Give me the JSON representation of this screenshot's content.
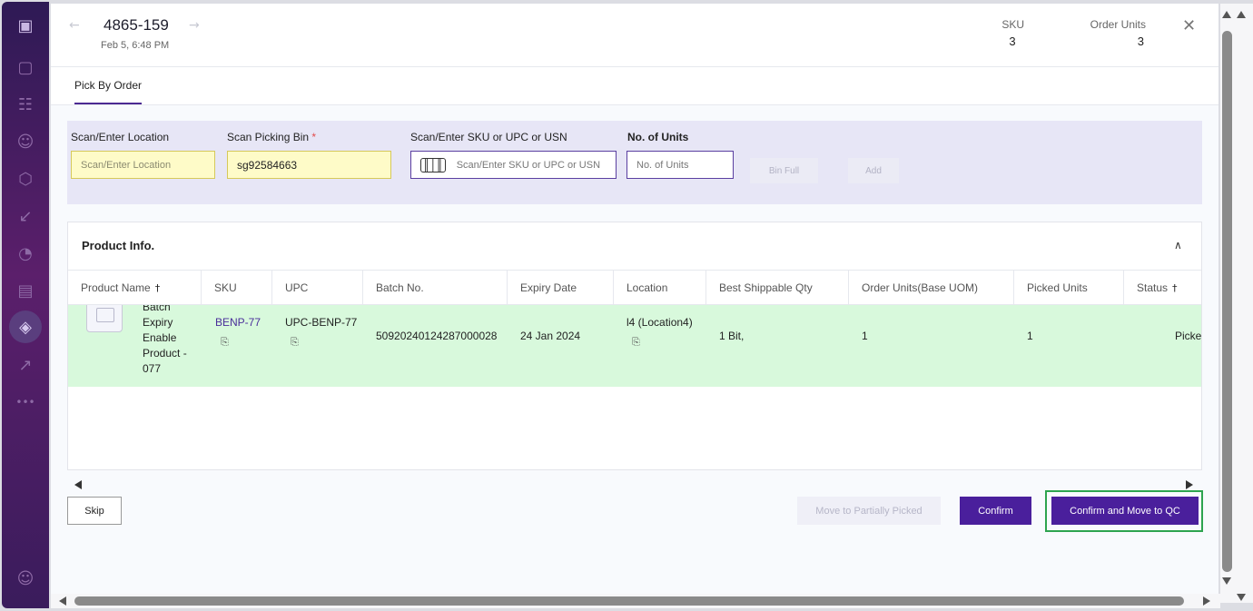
{
  "sidebar": {
    "icons": [
      "logo-icon",
      "dashboard-icon",
      "grid-icon",
      "users-icon",
      "box-icon",
      "inbound-icon",
      "chart-icon",
      "truck-icon",
      "layers-icon",
      "external-link-icon",
      "more-icon",
      "profile-icon"
    ],
    "active": "layers-icon"
  },
  "header": {
    "order_id": "4865-159",
    "date": "Feb 5, 6:48 PM",
    "sku_label": "SKU",
    "sku_value": "3",
    "order_units_label": "Order Units",
    "order_units_value": "3"
  },
  "tabs": [
    {
      "label": "Pick By Order",
      "active": true
    }
  ],
  "scan": {
    "location_label": "Scan/Enter Location",
    "location_placeholder": "Scan/Enter Location",
    "bin_label": "Scan Picking Bin",
    "bin_required": "*",
    "bin_value": "sg92584663",
    "sku_label": "Scan/Enter SKU or UPC or USN",
    "sku_placeholder": "Scan/Enter SKU or UPC or USN",
    "units_label": "No. of Units",
    "units_placeholder": "No. of Units",
    "bin_full_label": "Bin Full",
    "add_label": "Add"
  },
  "product_info": {
    "title": "Product Info.",
    "columns": [
      "Product Name",
      "SKU",
      "UPC",
      "Batch No.",
      "Expiry Date",
      "Location",
      "Best Shippable Qty",
      "Order Units(Base UOM)",
      "Picked Units",
      "Status"
    ],
    "rows": [
      {
        "product_name_lines": [
          "Batch",
          "Expiry",
          "Enable",
          "Product -",
          "077"
        ],
        "sku": "BENP-77",
        "upc": "UPC-BENP-77",
        "batch_no": "50920240124287000028",
        "expiry_date": "24 Jan 2024",
        "location": "l4 (Location4)",
        "best_shippable_qty": "1 Bit,",
        "order_units": "1",
        "picked_units": "1",
        "status": "Picked"
      }
    ]
  },
  "footer": {
    "skip_label": "Skip",
    "move_partial_label": "Move to Partially Picked",
    "confirm_label": "Confirm",
    "confirm_qc_label": "Confirm and Move to QC"
  },
  "colors": {
    "primary": "#4a1f9c",
    "row_highlight": "#d8f9dc",
    "scan_bg": "#e7e6f6",
    "focus_outline": "#2ea44f"
  }
}
